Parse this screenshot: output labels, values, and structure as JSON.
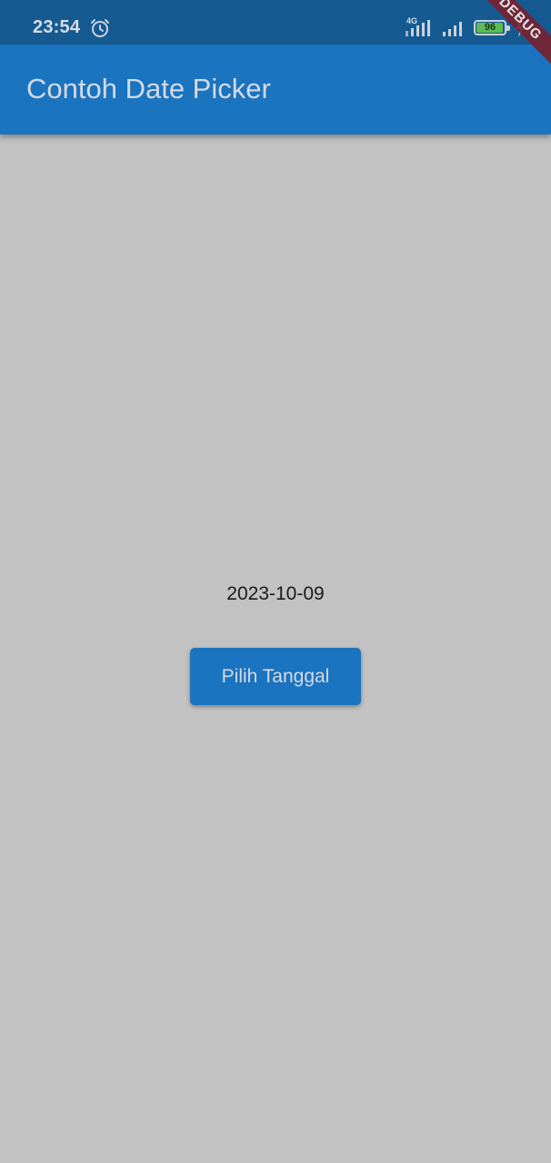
{
  "status_bar": {
    "time": "23:54",
    "network_label": "4G",
    "battery_percent": "96",
    "icons": [
      "alarm-icon",
      "signal-4g-icon",
      "signal-icon",
      "battery-icon",
      "charging-bolt-icon"
    ]
  },
  "app_bar": {
    "title": "Contoh Date Picker"
  },
  "debug_banner": {
    "label": "DEBUG"
  },
  "main": {
    "selected_date": "2023-10-09",
    "pick_button_label": "Pilih Tanggal"
  },
  "colors": {
    "status_bar": "#165a92",
    "app_bar": "#1b74bf",
    "background": "#c2c2c2",
    "button": "#1b74bf",
    "debug_ribbon": "#762332"
  }
}
